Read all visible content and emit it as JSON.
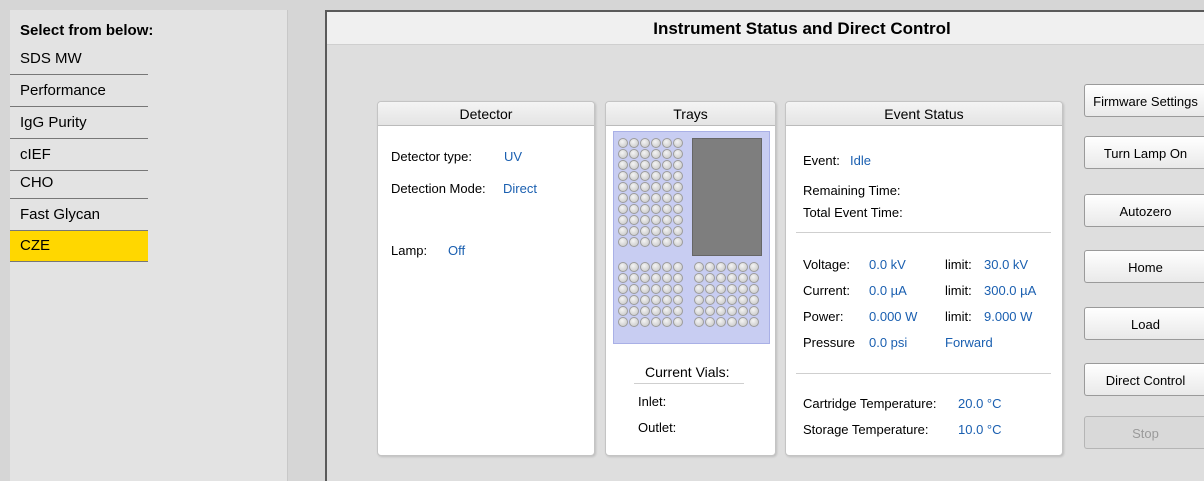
{
  "sidebar": {
    "header": "Select from below:",
    "items": [
      {
        "label": "SDS MW"
      },
      {
        "label": "Performance"
      },
      {
        "label": "IgG Purity"
      },
      {
        "label": "cIEF"
      },
      {
        "label": "CHO"
      },
      {
        "label": "Fast Glycan"
      },
      {
        "label": "CZE",
        "selected": true
      }
    ],
    "selected_color": "#ffd700"
  },
  "main": {
    "title": "Instrument Status and Direct Control"
  },
  "detector": {
    "title": "Detector",
    "type_label": "Detector type:",
    "type_value": "UV",
    "mode_label": "Detection Mode:",
    "mode_value": "Direct",
    "lamp_label": "Lamp:",
    "lamp_value": "Off"
  },
  "trays": {
    "title": "Trays",
    "current_vials_label": "Current Vials:",
    "inlet_label": "Inlet:",
    "outlet_label": "Outlet:"
  },
  "event_status": {
    "title": "Event Status",
    "event_label": "Event:",
    "event_value": "Idle",
    "remaining_label": "Remaining Time:",
    "total_label": "Total Event Time:",
    "voltage_label": "Voltage:",
    "voltage_value": "0.0 kV",
    "voltage_limit_label": "limit:",
    "voltage_limit": "30.0 kV",
    "current_label": "Current:",
    "current_value": "0.0 µA",
    "current_limit_label": "limit:",
    "current_limit": "300.0 µA",
    "power_label": "Power:",
    "power_value": "0.000 W",
    "power_limit_label": "limit:",
    "power_limit": "9.000 W",
    "pressure_label": "Pressure",
    "pressure_value": "0.0 psi",
    "pressure_direction": "Forward",
    "cartridge_temp_label": "Cartridge Temperature:",
    "cartridge_temp_value": "20.0 °C",
    "storage_temp_label": "Storage Temperature:",
    "storage_temp_value": "10.0 °C"
  },
  "buttons": {
    "firmware": "Firmware Settings",
    "lamp": "Turn Lamp On",
    "autozero": "Autozero",
    "home": "Home",
    "load": "Load",
    "direct_control": "Direct Control",
    "stop": "Stop"
  },
  "colors": {
    "value_text": "#1a5fb0",
    "tray_frame": "#c8cdf2",
    "tray_block": "#7e7e7e"
  }
}
